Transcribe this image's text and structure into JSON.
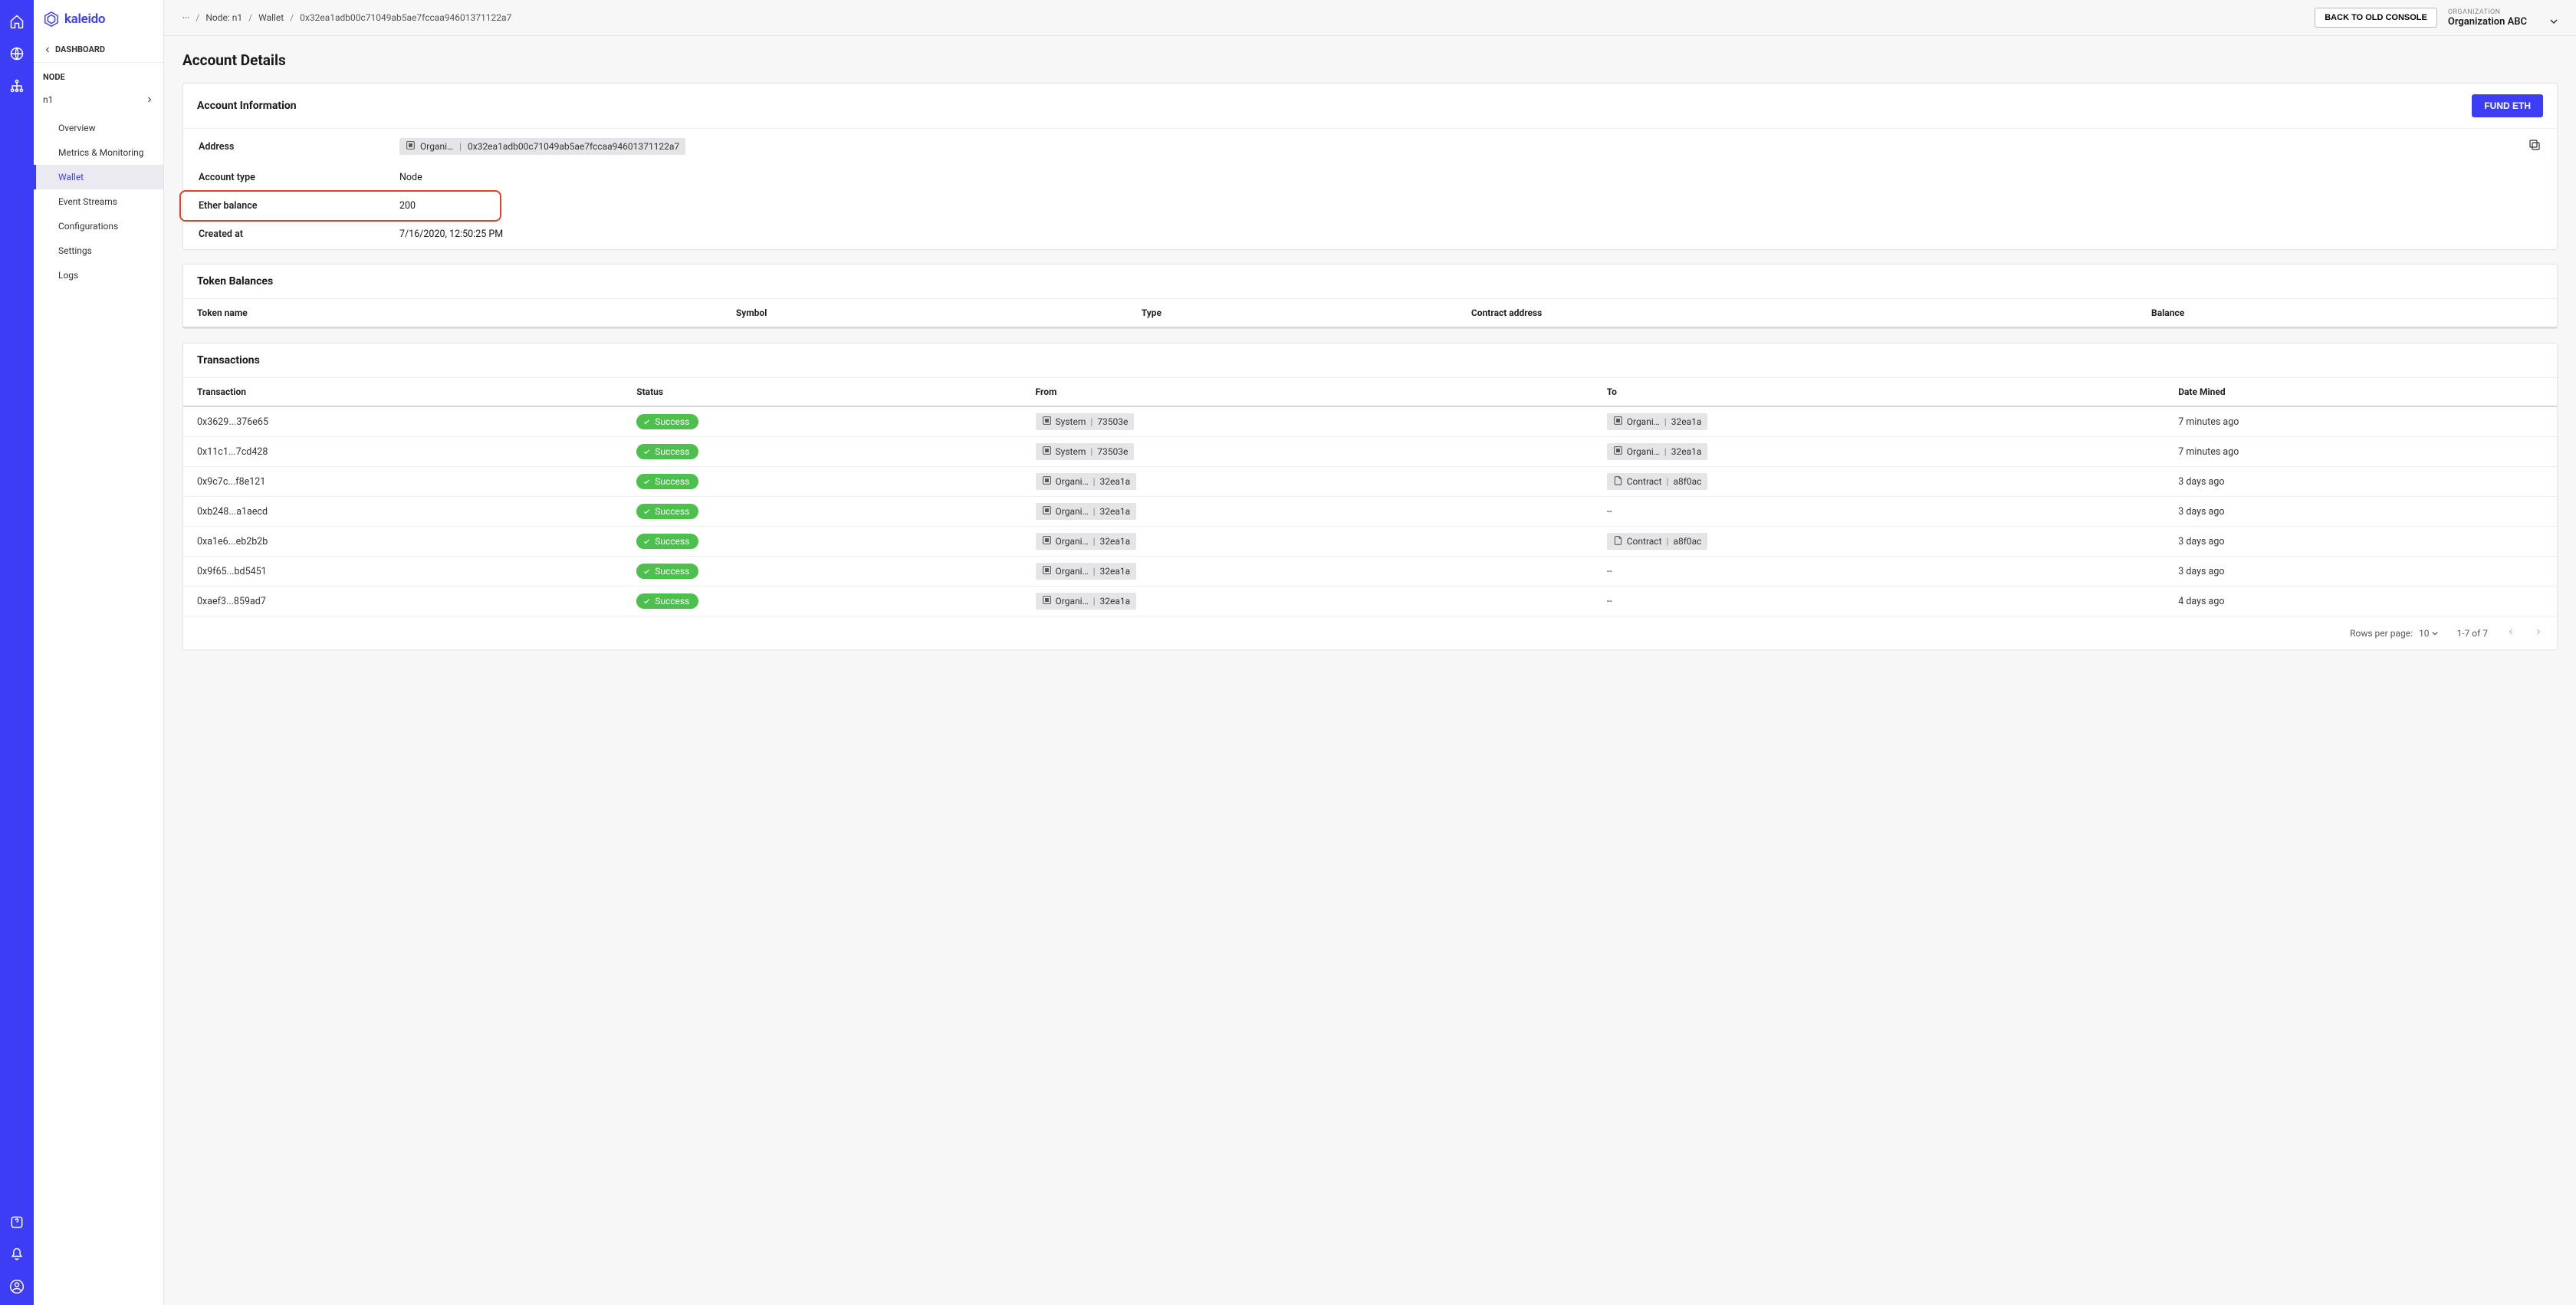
{
  "brand": "kaleido",
  "rail": {
    "home": "Home",
    "globe": "Network",
    "org": "Org",
    "help": "Help",
    "notifications": "Notifications",
    "account": "Account"
  },
  "sidebar": {
    "back_label": "DASHBOARD",
    "section_label": "NODE",
    "node_name": "n1",
    "items": [
      {
        "label": "Overview"
      },
      {
        "label": "Metrics & Monitoring"
      },
      {
        "label": "Wallet"
      },
      {
        "label": "Event Streams"
      },
      {
        "label": "Configurations"
      },
      {
        "label": "Settings"
      },
      {
        "label": "Logs"
      }
    ],
    "active_index": 2
  },
  "topbar": {
    "crumbs": [
      "···",
      "Node: n1",
      "Wallet",
      "0x32ea1adb00c71049ab5ae7fccaa94601371122a7"
    ],
    "back_button": "BACK TO OLD CONSOLE",
    "org_label": "ORGANIZATION",
    "org_value": "Organization ABC"
  },
  "page_title": "Account Details",
  "account_info": {
    "title": "Account Information",
    "fund_button": "FUND ETH",
    "rows": {
      "address_label": "Address",
      "address_chip_org": "Organi…",
      "address_value": "0x32ea1adb00c71049ab5ae7fccaa94601371122a7",
      "account_type_label": "Account type",
      "account_type_value": "Node",
      "ether_balance_label": "Ether balance",
      "ether_balance_value": "200",
      "created_at_label": "Created at",
      "created_at_value": "7/16/2020, 12:50:25 PM"
    }
  },
  "token_balances": {
    "title": "Token Balances",
    "columns": [
      "Token name",
      "Symbol",
      "Type",
      "Contract address",
      "Balance"
    ],
    "rows": []
  },
  "transactions": {
    "title": "Transactions",
    "columns": [
      "Transaction",
      "Status",
      "From",
      "To",
      "Date Mined"
    ],
    "status_label": "Success",
    "org_chip_label": "Organi…",
    "system_chip_label": "System",
    "contract_chip_label": "Contract",
    "rows": [
      {
        "tx": "0x3629...376e65",
        "from_type": "system",
        "from_id": "73503e",
        "to_type": "org",
        "to_id": "32ea1a",
        "date": "7 minutes ago"
      },
      {
        "tx": "0x11c1...7cd428",
        "from_type": "system",
        "from_id": "73503e",
        "to_type": "org",
        "to_id": "32ea1a",
        "date": "7 minutes ago"
      },
      {
        "tx": "0x9c7c...f8e121",
        "from_type": "org",
        "from_id": "32ea1a",
        "to_type": "contract",
        "to_id": "a8f0ac",
        "date": "3 days ago"
      },
      {
        "tx": "0xb248...a1aecd",
        "from_type": "org",
        "from_id": "32ea1a",
        "to_type": "none",
        "to_id": "--",
        "date": "3 days ago"
      },
      {
        "tx": "0xa1e6...eb2b2b",
        "from_type": "org",
        "from_id": "32ea1a",
        "to_type": "contract",
        "to_id": "a8f0ac",
        "date": "3 days ago"
      },
      {
        "tx": "0x9f65...bd5451",
        "from_type": "org",
        "from_id": "32ea1a",
        "to_type": "none",
        "to_id": "--",
        "date": "3 days ago"
      },
      {
        "tx": "0xaef3...859ad7",
        "from_type": "org",
        "from_id": "32ea1a",
        "to_type": "none",
        "to_id": "--",
        "date": "4 days ago"
      }
    ]
  },
  "pagination": {
    "rows_per_page_label": "Rows per page:",
    "rows_per_page_value": "10",
    "range": "1-7 of 7"
  }
}
